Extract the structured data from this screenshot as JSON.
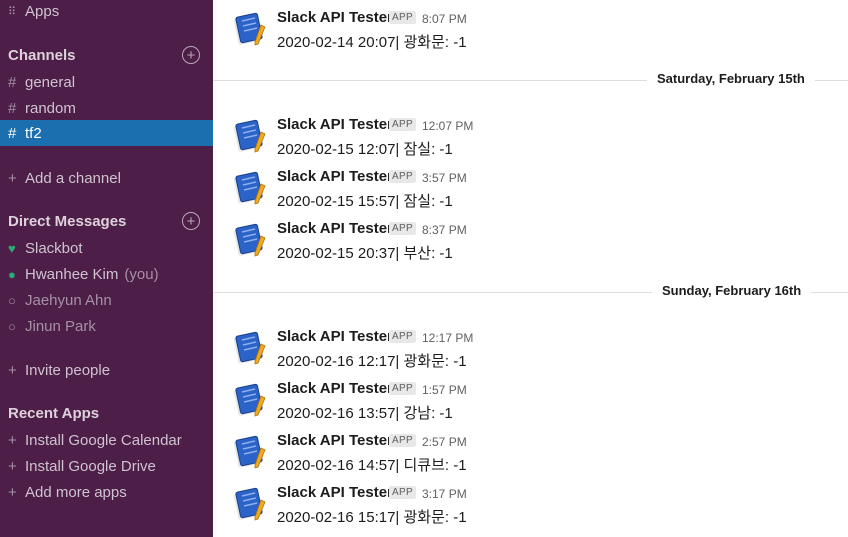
{
  "sidebar": {
    "apps_label": "Apps",
    "channels_header": "Channels",
    "channels": [
      {
        "name": "general",
        "active": false
      },
      {
        "name": "random",
        "active": false
      },
      {
        "name": "tf2",
        "active": true
      }
    ],
    "add_channel_label": "Add a channel",
    "dm_header": "Direct Messages",
    "dms": [
      {
        "name": "Slackbot",
        "suffix": ""
      },
      {
        "name": "Hwanhee Kim",
        "suffix": "(you)"
      },
      {
        "name": "Jaehyun Ahn",
        "suffix": ""
      },
      {
        "name": "Jinun Park",
        "suffix": ""
      }
    ],
    "invite_label": "Invite people",
    "recent_apps_header": "Recent Apps",
    "recent_apps": [
      "Install Google Calendar",
      "Install Google Drive",
      "Add more apps"
    ]
  },
  "main": {
    "badge_label": "APP",
    "dividers": [
      "Saturday, February 15th",
      "Sunday, February 16th"
    ],
    "messages": [
      {
        "sender": "Slack API Tester",
        "time": "8:07 PM",
        "text": "2020-02-14 20:07| 광화문: -1"
      },
      {
        "sender": "Slack API Tester",
        "time": "12:07 PM",
        "text": "2020-02-15 12:07| 잠실: -1"
      },
      {
        "sender": "Slack API Tester",
        "time": "3:57 PM",
        "text": "2020-02-15 15:57| 잠실: -1"
      },
      {
        "sender": "Slack API Tester",
        "time": "8:37 PM",
        "text": "2020-02-15 20:37| 부산: -1"
      },
      {
        "sender": "Slack API Tester",
        "time": "12:17 PM",
        "text": "2020-02-16 12:17| 광화문: -1"
      },
      {
        "sender": "Slack API Tester",
        "time": "1:57 PM",
        "text": "2020-02-16 13:57| 강남: -1"
      },
      {
        "sender": "Slack API Tester",
        "time": "2:57 PM",
        "text": "2020-02-16 14:57| 디큐브: -1"
      },
      {
        "sender": "Slack API Tester",
        "time": "3:17 PM",
        "text": "2020-02-16 15:17| 광화문: -1"
      }
    ]
  },
  "colors": {
    "sidebar_bg": "#4d1e48",
    "active_channel": "#1c6fae",
    "presence_online": "#2bac76"
  },
  "icons": [
    "apps-grid-icon",
    "add-circle-icon",
    "hash-icon",
    "plus-icon",
    "heart-icon",
    "presence-icon",
    "app-avatar-icon"
  ]
}
